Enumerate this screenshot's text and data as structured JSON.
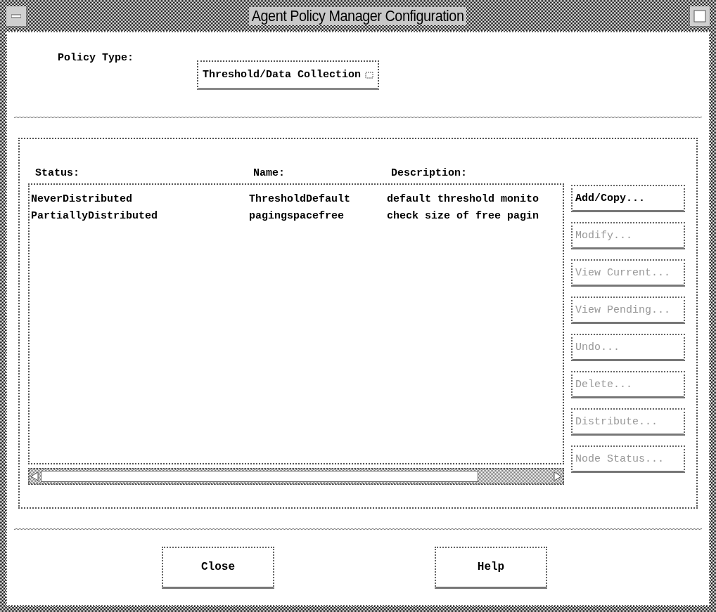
{
  "window": {
    "title": "Agent Policy Manager Configuration"
  },
  "policy_type": {
    "label": "Policy Type:",
    "value": "Threshold/Data Collection"
  },
  "table": {
    "columns": [
      "Status:",
      "Name:",
      "Description:"
    ],
    "rows": [
      {
        "cells": [
          "NeverDistributed",
          "ThresholdDefault",
          "default threshold monito"
        ],
        "selected": false
      },
      {
        "cells": [
          "PartiallyDistributed",
          "pagingspacefree",
          "check size of free pagin"
        ],
        "selected": false
      }
    ]
  },
  "actions": [
    {
      "label": "Add/Copy...",
      "disabled": false
    },
    {
      "label": "Modify...",
      "disabled": true
    },
    {
      "label": "View Current...",
      "disabled": true
    },
    {
      "label": "View Pending...",
      "disabled": true
    },
    {
      "label": "Undo...",
      "disabled": true
    },
    {
      "label": "Delete...",
      "disabled": true
    },
    {
      "label": "Distribute...",
      "disabled": true
    },
    {
      "label": "Node Status...",
      "disabled": true
    }
  ],
  "buttons": [
    "Close",
    "Help"
  ]
}
